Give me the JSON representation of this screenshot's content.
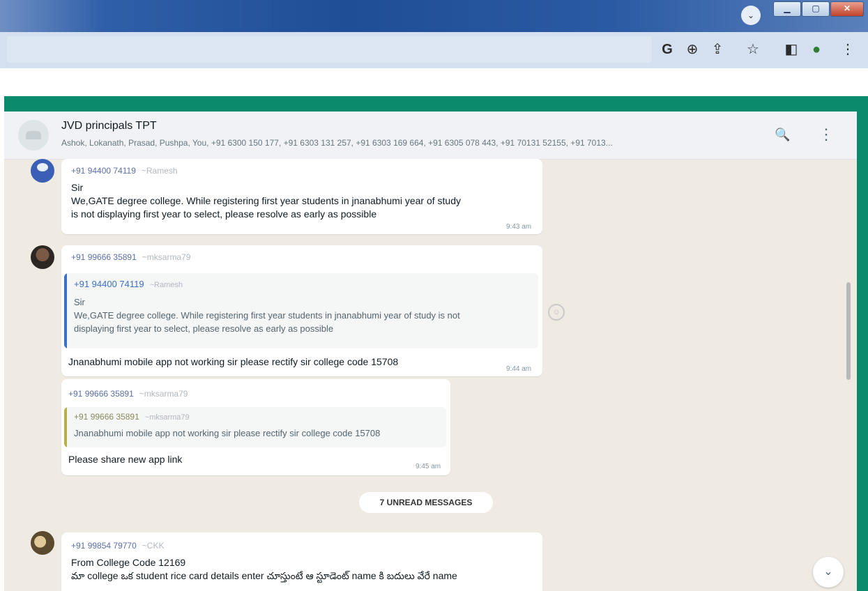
{
  "browser": {
    "toolbar_icons": [
      "google-icon",
      "zoom-icon",
      "share-icon",
      "star-icon",
      "sidepanel-icon",
      "profile-icon",
      "menu-icon"
    ],
    "glyphs": {
      "google": "G",
      "zoom": "⊕",
      "share": "⇪",
      "star": "☆",
      "sidepanel": "◧",
      "profile": "●",
      "menu": "⋮",
      "tab_down": "⌄",
      "minimize": "▁",
      "maximize": "▢",
      "close": "✕"
    }
  },
  "chat": {
    "title": "JVD principals TPT",
    "members": "Ashok, Lokanath, Prasad, Pushpa, You, +91 6300 150 177, +91 6303 131 257, +91 6303 169 664, +91 6305 078 443, +91 70131 52155, +91 7013...",
    "search_glyph": "🔍",
    "menu_glyph": "⋮",
    "unread_label": "7 UNREAD MESSAGES",
    "scroll_down_glyph": "⌄",
    "react_glyph": "☺"
  },
  "messages": [
    {
      "sender": "+91 94400 74119",
      "alias": "~Ramesh",
      "lines": [
        "Sir",
        "We,GATE degree college. While registering first year students in jnanabhumi year of study",
        "is not displaying first year to select, please resolve as early as possible"
      ],
      "time": "9:43 am"
    },
    {
      "sender": "+91 99666 35891",
      "alias": "~mksarma79",
      "quote": {
        "sender": "+91 94400 74119",
        "alias": "~Ramesh",
        "lines": [
          "Sir",
          "We,GATE degree college. While registering first year students in jnanabhumi year of study is not",
          "displaying first year to select, please resolve as early as possible"
        ]
      },
      "text": "Jnanabhumi mobile app not working sir please rectify sir college code 15708",
      "time": "9:44 am"
    },
    {
      "sender": "+91 99666 35891",
      "alias": "~mksarma79",
      "quote": {
        "sender": "+91 99666 35891",
        "alias": "~mksarma79",
        "lines": [
          "Jnanabhumi mobile app not working sir please rectify sir college code 15708"
        ]
      },
      "text": "Please share new  app link",
      "time": "9:45 am"
    },
    {
      "sender": "+91 99854 79770",
      "alias": "~CKK",
      "lines": [
        "From College Code 12169",
        "మా college ఒక student rice card details enter చూస్తుంటే ఆ స్టూడెంట్ name కి బదులు వేరే name"
      ]
    }
  ],
  "colors": {
    "accent_green": "#0b8a6c",
    "chat_bg": "#efeae2",
    "header_bg": "#f0f2f5",
    "quote_bar_blue": "#3b70c8",
    "quote_bar_olive": "#b7b04a"
  }
}
